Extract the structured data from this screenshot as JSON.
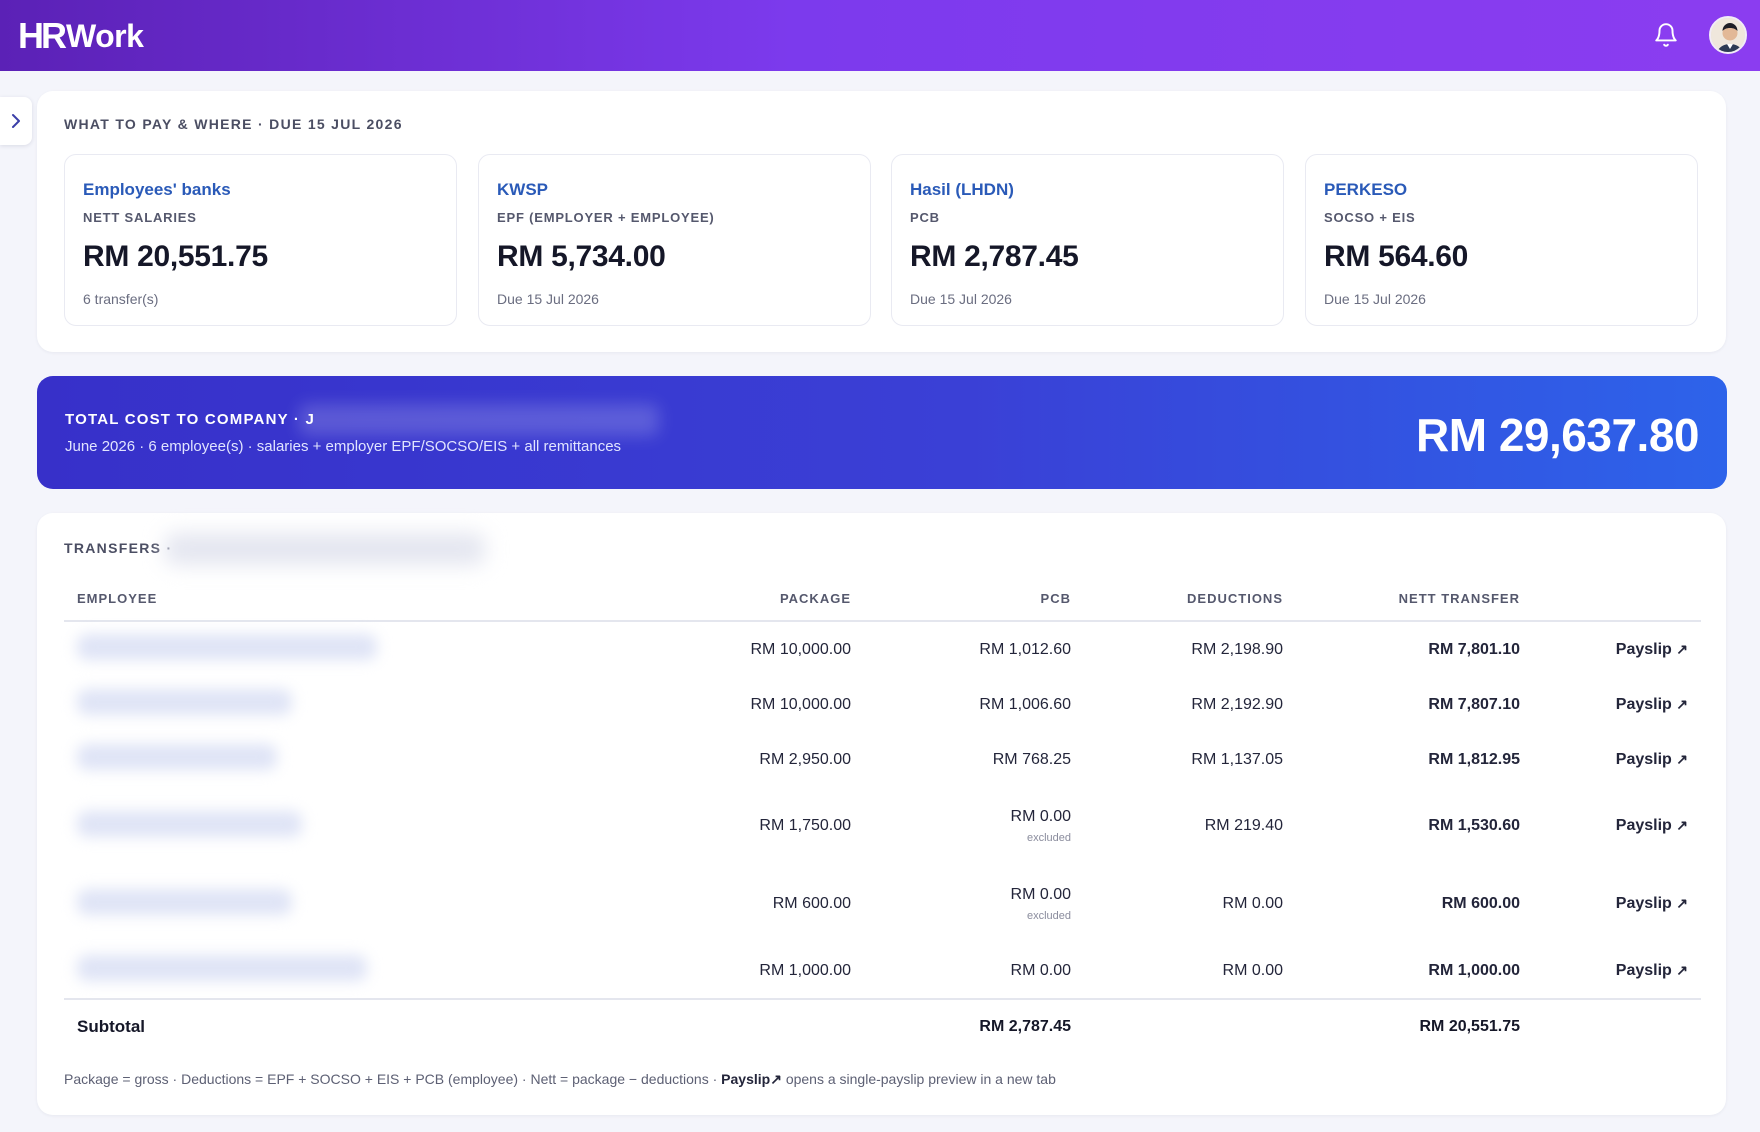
{
  "app": {
    "logo_mark": "HR",
    "logo_text": "Work"
  },
  "pay_section": {
    "title": "WHAT TO PAY & WHERE · DUE 15 JUL 2026",
    "cards": [
      {
        "name": "Employees' banks",
        "sub": "NETT SALARIES",
        "amount": "RM 20,551.75",
        "note": "6 transfer(s)"
      },
      {
        "name": "KWSP",
        "sub": "EPF (EMPLOYER + EMPLOYEE)",
        "amount": "RM 5,734.00",
        "note": "Due 15 Jul 2026"
      },
      {
        "name": "Hasil (LHDN)",
        "sub": "PCB",
        "amount": "RM 2,787.45",
        "note": "Due 15 Jul 2026"
      },
      {
        "name": "PERKESO",
        "sub": "SOCSO + EIS",
        "amount": "RM 564.60",
        "note": "Due 15 Jul 2026"
      }
    ]
  },
  "total": {
    "label": "TOTAL COST TO COMPANY · J",
    "desc": "June 2026 · 6 employee(s) · salaries + employer EPF/SOCSO/EIS + all remittances",
    "amount": "RM 29,637.80"
  },
  "transfers": {
    "title": "TRANSFERS ·",
    "columns": [
      "EMPLOYEE",
      "PACKAGE",
      "PCB",
      "DEDUCTIONS",
      "NETT TRANSFER"
    ],
    "rows": [
      {
        "package": "RM 10,000.00",
        "pcb": "RM 1,012.60",
        "pcb_note": "",
        "deductions": "RM 2,198.90",
        "nett": "RM 7,801.10",
        "action": "Payslip"
      },
      {
        "package": "RM 10,000.00",
        "pcb": "RM 1,006.60",
        "pcb_note": "",
        "deductions": "RM 2,192.90",
        "nett": "RM 7,807.10",
        "action": "Payslip"
      },
      {
        "package": "RM 2,950.00",
        "pcb": "RM 768.25",
        "pcb_note": "",
        "deductions": "RM 1,137.05",
        "nett": "RM 1,812.95",
        "action": "Payslip"
      },
      {
        "package": "RM 1,750.00",
        "pcb": "RM 0.00",
        "pcb_note": "excluded",
        "deductions": "RM 219.40",
        "nett": "RM 1,530.60",
        "action": "Payslip"
      },
      {
        "package": "RM 600.00",
        "pcb": "RM 0.00",
        "pcb_note": "excluded",
        "deductions": "RM 0.00",
        "nett": "RM 600.00",
        "action": "Payslip"
      },
      {
        "package": "RM 1,000.00",
        "pcb": "RM 0.00",
        "pcb_note": "",
        "deductions": "RM 0.00",
        "nett": "RM 1,000.00",
        "action": "Payslip"
      }
    ],
    "subtotal": {
      "label": "Subtotal",
      "pcb": "RM 2,787.45",
      "nett": "RM 20,551.75"
    },
    "footnote_pre": "Package = gross · Deductions = EPF + SOCSO + EIS + PCB (employee) · Nett = package − deductions ·",
    "footnote_link": "Payslip",
    "footnote_post": "opens a single-payslip preview in a new tab"
  },
  "icons": {
    "arrow": "↗"
  },
  "colors": {
    "header_start": "#5b21b6",
    "header_end": "#8b3df0",
    "total_start": "#3730c9",
    "total_end": "#2d63ea",
    "link": "#2a5ab8"
  }
}
